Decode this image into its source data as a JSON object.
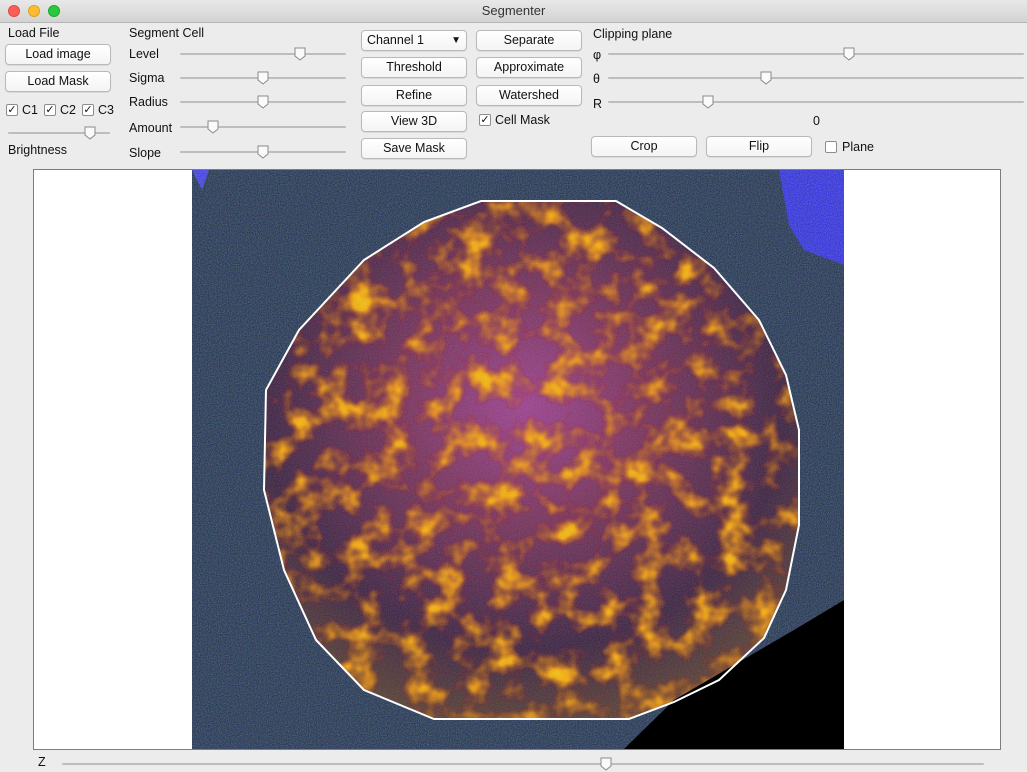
{
  "window": {
    "title": "Segmenter"
  },
  "load_file": {
    "section_label": "Load File",
    "load_image_label": "Load image",
    "load_mask_label": "Load Mask",
    "channels": [
      {
        "label": "C1",
        "checked": true
      },
      {
        "label": "C2",
        "checked": true
      },
      {
        "label": "C3",
        "checked": true
      }
    ],
    "brightness_label": "Brightness",
    "brightness_value": 0.8
  },
  "segment_cell": {
    "section_label": "Segment Cell",
    "sliders": [
      {
        "label": "Level",
        "value": 0.72
      },
      {
        "label": "Sigma",
        "value": 0.5
      },
      {
        "label": "Radius",
        "value": 0.5
      },
      {
        "label": "Amount",
        "value": 0.2
      },
      {
        "label": "Slope",
        "value": 0.5
      }
    ]
  },
  "actions": {
    "channel_select": "Channel 1",
    "threshold_label": "Threshold",
    "refine_label": "Refine",
    "view3d_label": "View 3D",
    "save_mask_label": "Save Mask",
    "separate_label": "Separate",
    "approximate_label": "Approximate",
    "watershed_label": "Watershed",
    "cell_mask_label": "Cell Mask",
    "cell_mask_checked": true
  },
  "clipping_plane": {
    "section_label": "Clipping plane",
    "sliders": [
      {
        "label": "φ",
        "value": 0.58
      },
      {
        "label": "θ",
        "value": 0.38
      },
      {
        "label": "R",
        "value": 0.24
      }
    ],
    "value_readout": "0",
    "crop_label": "Crop",
    "flip_label": "Flip",
    "plane_label": "Plane",
    "plane_checked": false
  },
  "z_slider": {
    "label": "Z",
    "value": 0.59
  },
  "colors": {
    "cell_outline": "#ffffff",
    "background_blue": "#1a1a6e",
    "cell_fill": "#c0442a"
  }
}
